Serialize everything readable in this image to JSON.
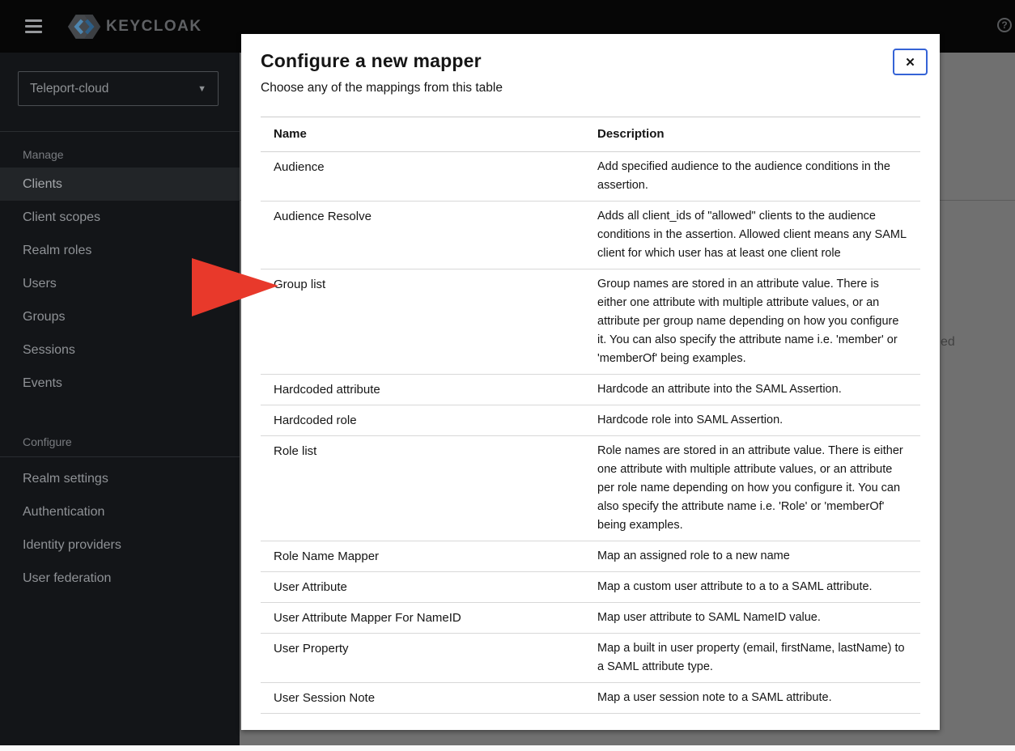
{
  "colors": {
    "accent-blue": "#3563d6",
    "arrow-red": "#e8392b"
  },
  "header": {
    "brand": "KEYCLOAK",
    "help_glyph": "?"
  },
  "sidebar": {
    "realm_selector": {
      "value": "Teleport-cloud",
      "caret": "▼"
    },
    "groups": [
      {
        "label": "Manage",
        "items": [
          "Clients",
          "Client scopes",
          "Realm roles",
          "Users",
          "Groups",
          "Sessions",
          "Events"
        ],
        "selected": "Clients"
      },
      {
        "label": "Configure",
        "items": [
          "Realm settings",
          "Authentication",
          "Identity providers",
          "User federation"
        ]
      }
    ]
  },
  "background": {
    "partial_text": "ed"
  },
  "annotation": {
    "target": "Group list",
    "shape": "red-right-arrow"
  },
  "modal": {
    "title": "Configure a new mapper",
    "subtitle": "Choose any of the mappings from this table",
    "close_glyph": "✕",
    "table": {
      "columns": [
        "Name",
        "Description"
      ],
      "rows": [
        {
          "name": "Audience",
          "description": "Add specified audience to the audience conditions in the assertion."
        },
        {
          "name": "Audience Resolve",
          "description": "Adds all client_ids of \"allowed\" clients to the audience conditions in the assertion. Allowed client means any SAML client for which user has at least one client role"
        },
        {
          "name": "Group list",
          "description": "Group names are stored in an attribute value. There is either one attribute with multiple attribute values, or an attribute per group name depending on how you configure it. You can also specify the attribute name i.e. 'member' or 'memberOf' being examples."
        },
        {
          "name": "Hardcoded attribute",
          "description": "Hardcode an attribute into the SAML Assertion."
        },
        {
          "name": "Hardcoded role",
          "description": "Hardcode role into SAML Assertion."
        },
        {
          "name": "Role list",
          "description": "Role names are stored in an attribute value. There is either one attribute with multiple attribute values, or an attribute per role name depending on how you configure it. You can also specify the attribute name i.e. 'Role' or 'memberOf' being examples."
        },
        {
          "name": "Role Name Mapper",
          "description": "Map an assigned role to a new name"
        },
        {
          "name": "User Attribute",
          "description": "Map a custom user attribute to a to a SAML attribute."
        },
        {
          "name": "User Attribute Mapper For NameID",
          "description": "Map user attribute to SAML NameID value."
        },
        {
          "name": "User Property",
          "description": "Map a built in user property (email, firstName, lastName) to a SAML attribute type."
        },
        {
          "name": "User Session Note",
          "description": "Map a user session note to a SAML attribute."
        }
      ]
    }
  }
}
